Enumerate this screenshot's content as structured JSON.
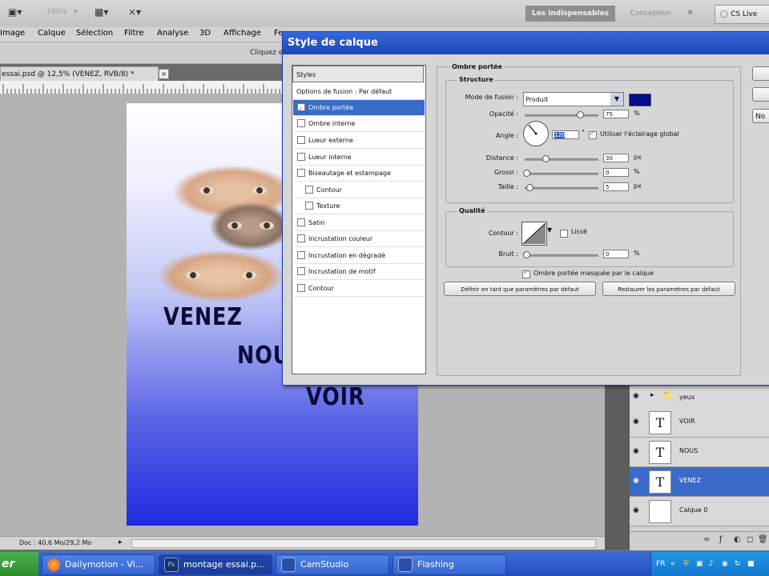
{
  "appbar": {
    "zoom_label": "100%",
    "workspace_active": "Les indispensables",
    "workspace_other": "Conception",
    "more_label": "»",
    "cslive_label": "CS Live"
  },
  "menu": [
    "Image",
    "Calque",
    "Sélection",
    "Filtre",
    "Analyse",
    "3D",
    "Affichage",
    "Fe"
  ],
  "options_hint": "Cliquez e",
  "document": {
    "tab_label": "essai.psd @ 12,5% (VENEZ, RVB/8) *",
    "tab_close": "×",
    "words": [
      "VENEZ",
      "NOUS",
      "VOIR"
    ],
    "status_doc": "Doc : 40,6 Mo/29,2 Mo"
  },
  "layers": [
    {
      "name": "yeux",
      "type": "group"
    },
    {
      "name": "VOIR",
      "type": "text",
      "thumb": "T"
    },
    {
      "name": "NOUS",
      "type": "text",
      "thumb": "T"
    },
    {
      "name": "VENEZ",
      "type": "text",
      "thumb": "T",
      "selected": true
    },
    {
      "name": "Calque 0",
      "type": "pixel"
    }
  ],
  "dialog": {
    "title": "Style de calque",
    "styles_header": "Styles",
    "style_items": [
      {
        "label": "Options de fusion : Par défaut",
        "checkbox": false
      },
      {
        "label": "Ombre portée",
        "checkbox": true,
        "checked": true,
        "selected": true
      },
      {
        "label": "Ombre interne",
        "checkbox": true
      },
      {
        "label": "Lueur externe",
        "checkbox": true
      },
      {
        "label": "Lueur interne",
        "checkbox": true
      },
      {
        "label": "Biseautage et estampage",
        "checkbox": true
      },
      {
        "label": "Contour",
        "checkbox": true,
        "sub": true
      },
      {
        "label": "Texture",
        "checkbox": true,
        "sub": true
      },
      {
        "label": "Satin",
        "checkbox": true
      },
      {
        "label": "Incrustation couleur",
        "checkbox": true
      },
      {
        "label": "Incrustation en dégradé",
        "checkbox": true
      },
      {
        "label": "Incrustation de motif",
        "checkbox": true
      },
      {
        "label": "Contour",
        "checkbox": true
      }
    ],
    "section_title": "Ombre portée",
    "structure": {
      "title": "Structure",
      "blend_mode_label": "Mode de fusion :",
      "blend_mode_value": "Produit",
      "shadow_color": "#00108a",
      "opacity_label": "Opacité :",
      "opacity_value": "75",
      "opacity_fraction": 0.75,
      "angle_label": "Angle :",
      "angle_value": "120",
      "angle_unit": "°",
      "global_light_label": "Utiliser l'éclairage global",
      "global_light_checked": true,
      "distance_label": "Distance :",
      "distance_value": "30",
      "distance_unit": "px",
      "spread_label": "Grossi :",
      "spread_value": "0",
      "spread_unit": "%",
      "size_label": "Taille :",
      "size_value": "5",
      "size_unit": "px",
      "percent_unit": "%"
    },
    "quality": {
      "title": "Qualité",
      "contour_label": "Contour :",
      "antialias_label": "Lissé",
      "noise_label": "Bruit :",
      "noise_value": "0",
      "noise_unit": "%"
    },
    "knockout_label": "Ombre portée masquée par le calque",
    "knockout_checked": true,
    "btn_set_default": "Définir en tant que paramètres par défaut",
    "btn_reset_default": "Restaurer les paramètres par défaut",
    "right_btn_3": "No"
  },
  "taskbar": {
    "start_label": "er",
    "tasks": [
      "Dailymotion - Vi...",
      "montage essai.p...",
      "CamStudio",
      "Flashing"
    ],
    "tray_lang": "FR"
  }
}
